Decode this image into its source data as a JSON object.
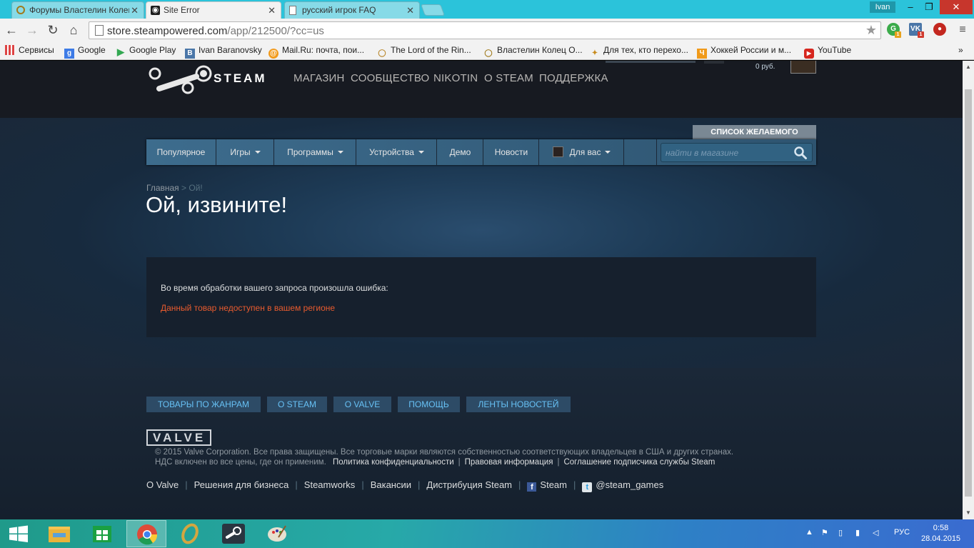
{
  "browser": {
    "tabs": [
      {
        "label": "Форумы Властелин Колец",
        "icon": "ring-icon"
      },
      {
        "label": "Site Error",
        "icon": "steam-icon"
      },
      {
        "label": "русский игрок FAQ",
        "icon": "page-icon"
      }
    ],
    "user": "Ivan",
    "url_host": "store.steampowered.com",
    "url_path": "/app/212500/?cc=us",
    "ext_badges": [
      "1",
      "1"
    ],
    "bookmarks": [
      {
        "label": "Сервисы",
        "icon": "apps-icon"
      },
      {
        "label": "Google",
        "icon": "google-icon"
      },
      {
        "label": "Google Play",
        "icon": "play-icon"
      },
      {
        "label": "Ivan Baranovsky",
        "icon": "b-icon"
      },
      {
        "label": "Mail.Ru: почта, пои...",
        "icon": "mail-icon"
      },
      {
        "label": "The Lord of the Rin...",
        "icon": "ring-icon"
      },
      {
        "label": "Властелин Колец О...",
        "icon": "ring-icon"
      },
      {
        "label": "Для тех, кто перехо...",
        "icon": "bookmark-icon"
      },
      {
        "label": "Хоккей России и м...",
        "icon": "hockey-icon"
      },
      {
        "label": "YouTube",
        "icon": "youtube-icon"
      }
    ],
    "more": "»"
  },
  "steam": {
    "logo_text": "STEAM",
    "nav": [
      "МАГАЗИН",
      "СООБЩЕСТВО",
      "NIKOTIN",
      "О STEAM",
      "ПОДДЕРЖКА"
    ],
    "balance": "0 руб.",
    "wishlist": "СПИСОК ЖЕЛАЕМОГО",
    "subnav": [
      {
        "label": "Популярное"
      },
      {
        "label": "Игры"
      },
      {
        "label": "Программы"
      },
      {
        "label": "Устройства"
      },
      {
        "label": "Демо"
      },
      {
        "label": "Новости"
      },
      {
        "label": "Для вас"
      }
    ],
    "search_placeholder": "найти в магазине",
    "breadcrumb_home": "Главная",
    "breadcrumb_sep": ">",
    "breadcrumb_current": "Ой!",
    "title": "Ой, извините!",
    "error_msg": "Во время обработки вашего запроса произошла ошибка:",
    "error_detail": "Данный товар недоступен в вашем регионе"
  },
  "footer": {
    "buttons": [
      "ТОВАРЫ ПО ЖАНРАМ",
      "О STEAM",
      "О VALVE",
      "ПОМОЩЬ",
      "ЛЕНТЫ НОВОСТЕЙ"
    ],
    "valve_logo": "VALVE",
    "copyright": "© 2015 Valve Corporation. Все права защищены. Все торговые марки являются собственностью соответствующих владельцев в США и других странах.",
    "vat": "НДС включен во все цены, где он применим.",
    "privacy": "Политика конфиденциальности",
    "legal": "Правовая информация",
    "ssa": "Соглашение подписчика службы Steam",
    "separator": "|",
    "links": [
      "О Valve",
      "Решения для бизнеса",
      "Steamworks",
      "Вакансии",
      "Дистрибуция Steam"
    ],
    "fb": "Steam",
    "twitter": "@steam_games"
  },
  "taskbar": {
    "lang": "РУС",
    "time": "0:58",
    "date": "28.04.2015"
  },
  "colors": {
    "error_red": "#e95b2e",
    "link_blue": "#67c1f5",
    "page_bg": "#1b2838"
  }
}
